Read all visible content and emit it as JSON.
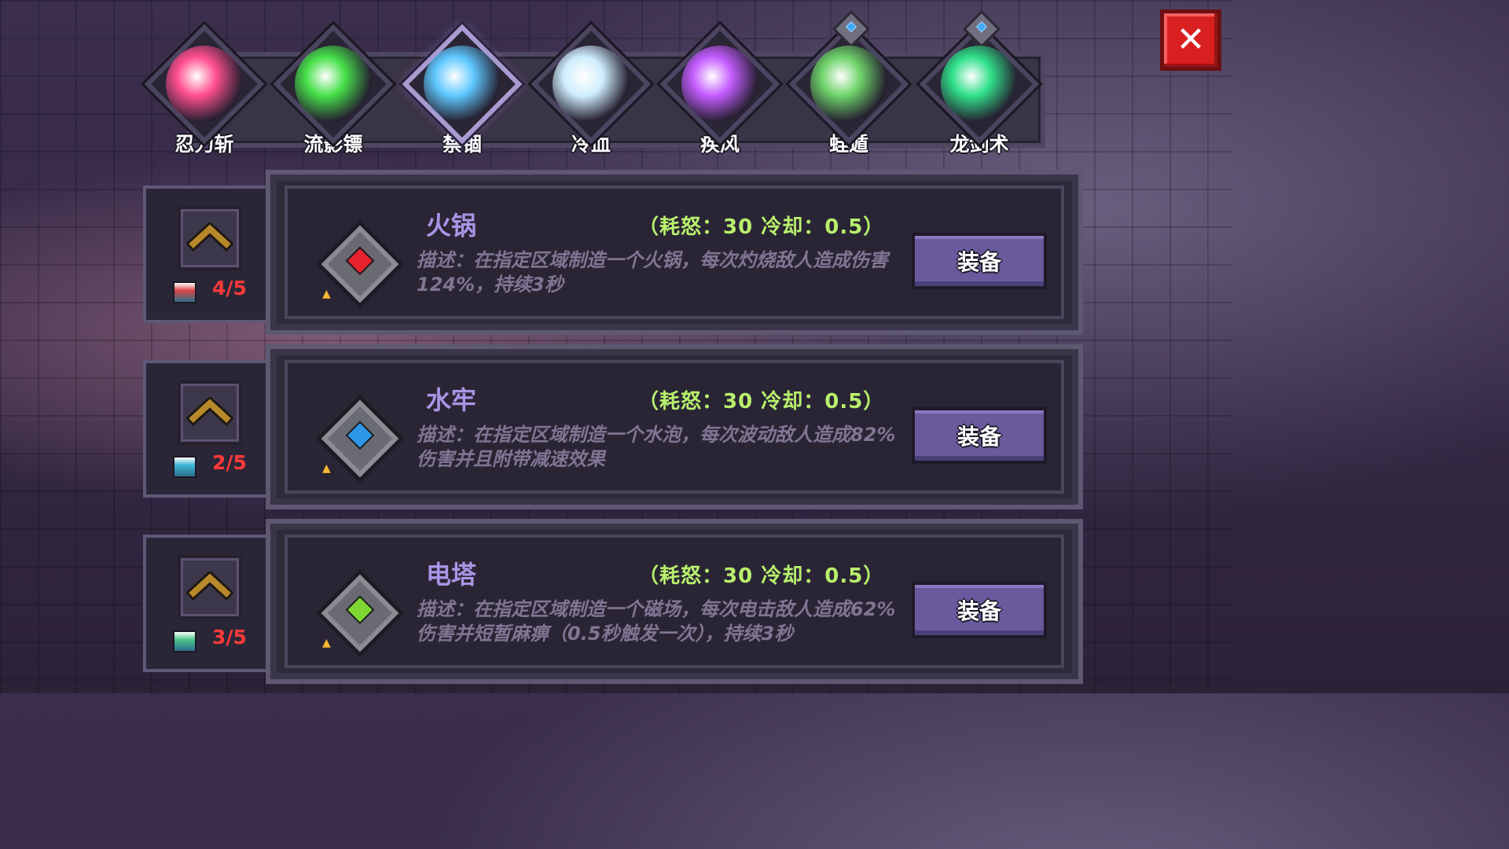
{
  "skills": [
    {
      "label": "忍刀斩",
      "icon": "pink-slash-icon",
      "color": "#ff4f8e",
      "active": false,
      "badge": false
    },
    {
      "label": "流影镖",
      "icon": "green-shuriken-icon",
      "color": "#47e04a",
      "active": false,
      "badge": false
    },
    {
      "label": "禁锢",
      "icon": "blue-orb-icon",
      "color": "#5fc8ff",
      "active": true,
      "badge": false
    },
    {
      "label": "冷血",
      "icon": "ice-burst-icon",
      "color": "#cfeefe",
      "active": false,
      "badge": false
    },
    {
      "label": "疾风",
      "icon": "purple-flame-icon",
      "color": "#c45cff",
      "active": false,
      "badge": false
    },
    {
      "label": "蛙遁",
      "icon": "frog-icon",
      "color": "#6ed36a",
      "active": false,
      "badge": true
    },
    {
      "label": "龙剑术",
      "icon": "green-blades-icon",
      "color": "#30e08a",
      "active": false,
      "badge": true
    }
  ],
  "close_label": "✕",
  "cards": [
    {
      "title": "火锅",
      "stats": "（耗怒：30  冷却：0.5）",
      "description": "描述：在指定区域制造一个火锅，每次灼烧敌人造成伤害124%，持续3秒",
      "equip_label": "装备",
      "core_color": "#e8232d",
      "level": "4/5",
      "level_icon_color": "#d94545"
    },
    {
      "title": "水牢",
      "stats": "（耗怒：30  冷却：0.5）",
      "description": "描述：在指定区域制造一个水泡，每次波动敌人造成82%伤害并且附带减速效果",
      "equip_label": "装备",
      "core_color": "#2f98e6",
      "level": "2/5",
      "level_icon_color": "#3fb5d6"
    },
    {
      "title": "电塔",
      "stats": "（耗怒：30  冷却：0.5）",
      "description": "描述：在指定区域制造一个磁场，每次电击敌人造成62%伤害并短暂麻痹（0.5秒触发一次），持续3秒",
      "equip_label": "装备",
      "core_color": "#7fd630",
      "level": "3/5",
      "level_icon_color": "#4cc48a"
    }
  ]
}
